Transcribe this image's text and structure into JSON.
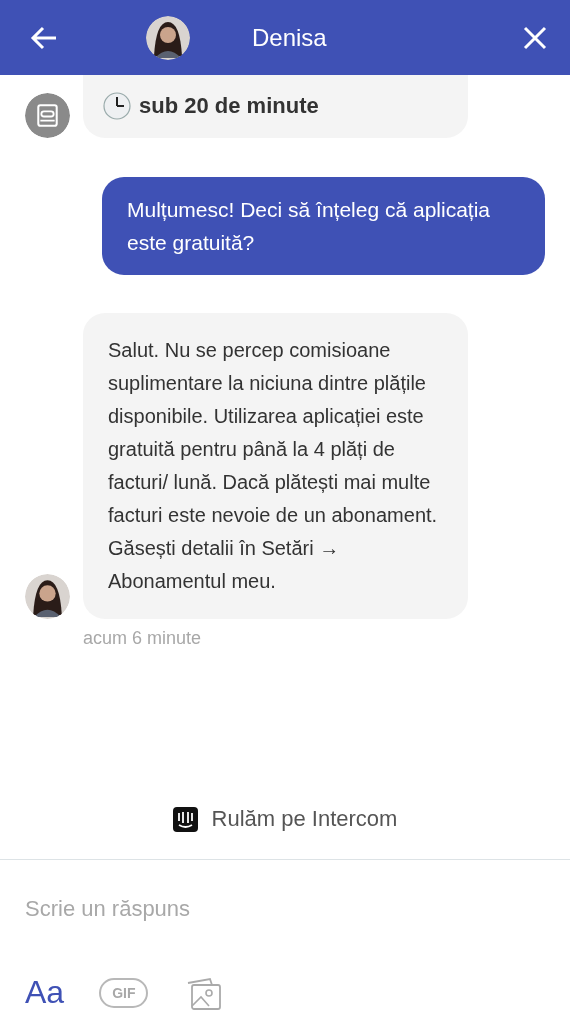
{
  "header": {
    "title": "Denisa"
  },
  "messages": [
    {
      "kind": "bot",
      "reply_time": "sub 20 de minute"
    },
    {
      "kind": "user",
      "text": "Mulțumesc! Deci să înțeleg că aplicația este gratuită?"
    },
    {
      "kind": "agent",
      "text": "Salut. Nu se percep comisioane suplimentare la niciuna dintre plățile disponibile. Utilizarea aplicației este gratuită pentru până la 4 plăți de facturi/ lună. Dacă plătești mai multe facturi este nevoie de un abonament. Găsești detalii în Setări → Abonamentul meu.",
      "time": "acum 6 minute"
    }
  ],
  "branding": "Rulăm pe Intercom",
  "composer": {
    "placeholder": "Scrie un răspuns",
    "format_label": "Aa",
    "gif_label": "GIF"
  }
}
